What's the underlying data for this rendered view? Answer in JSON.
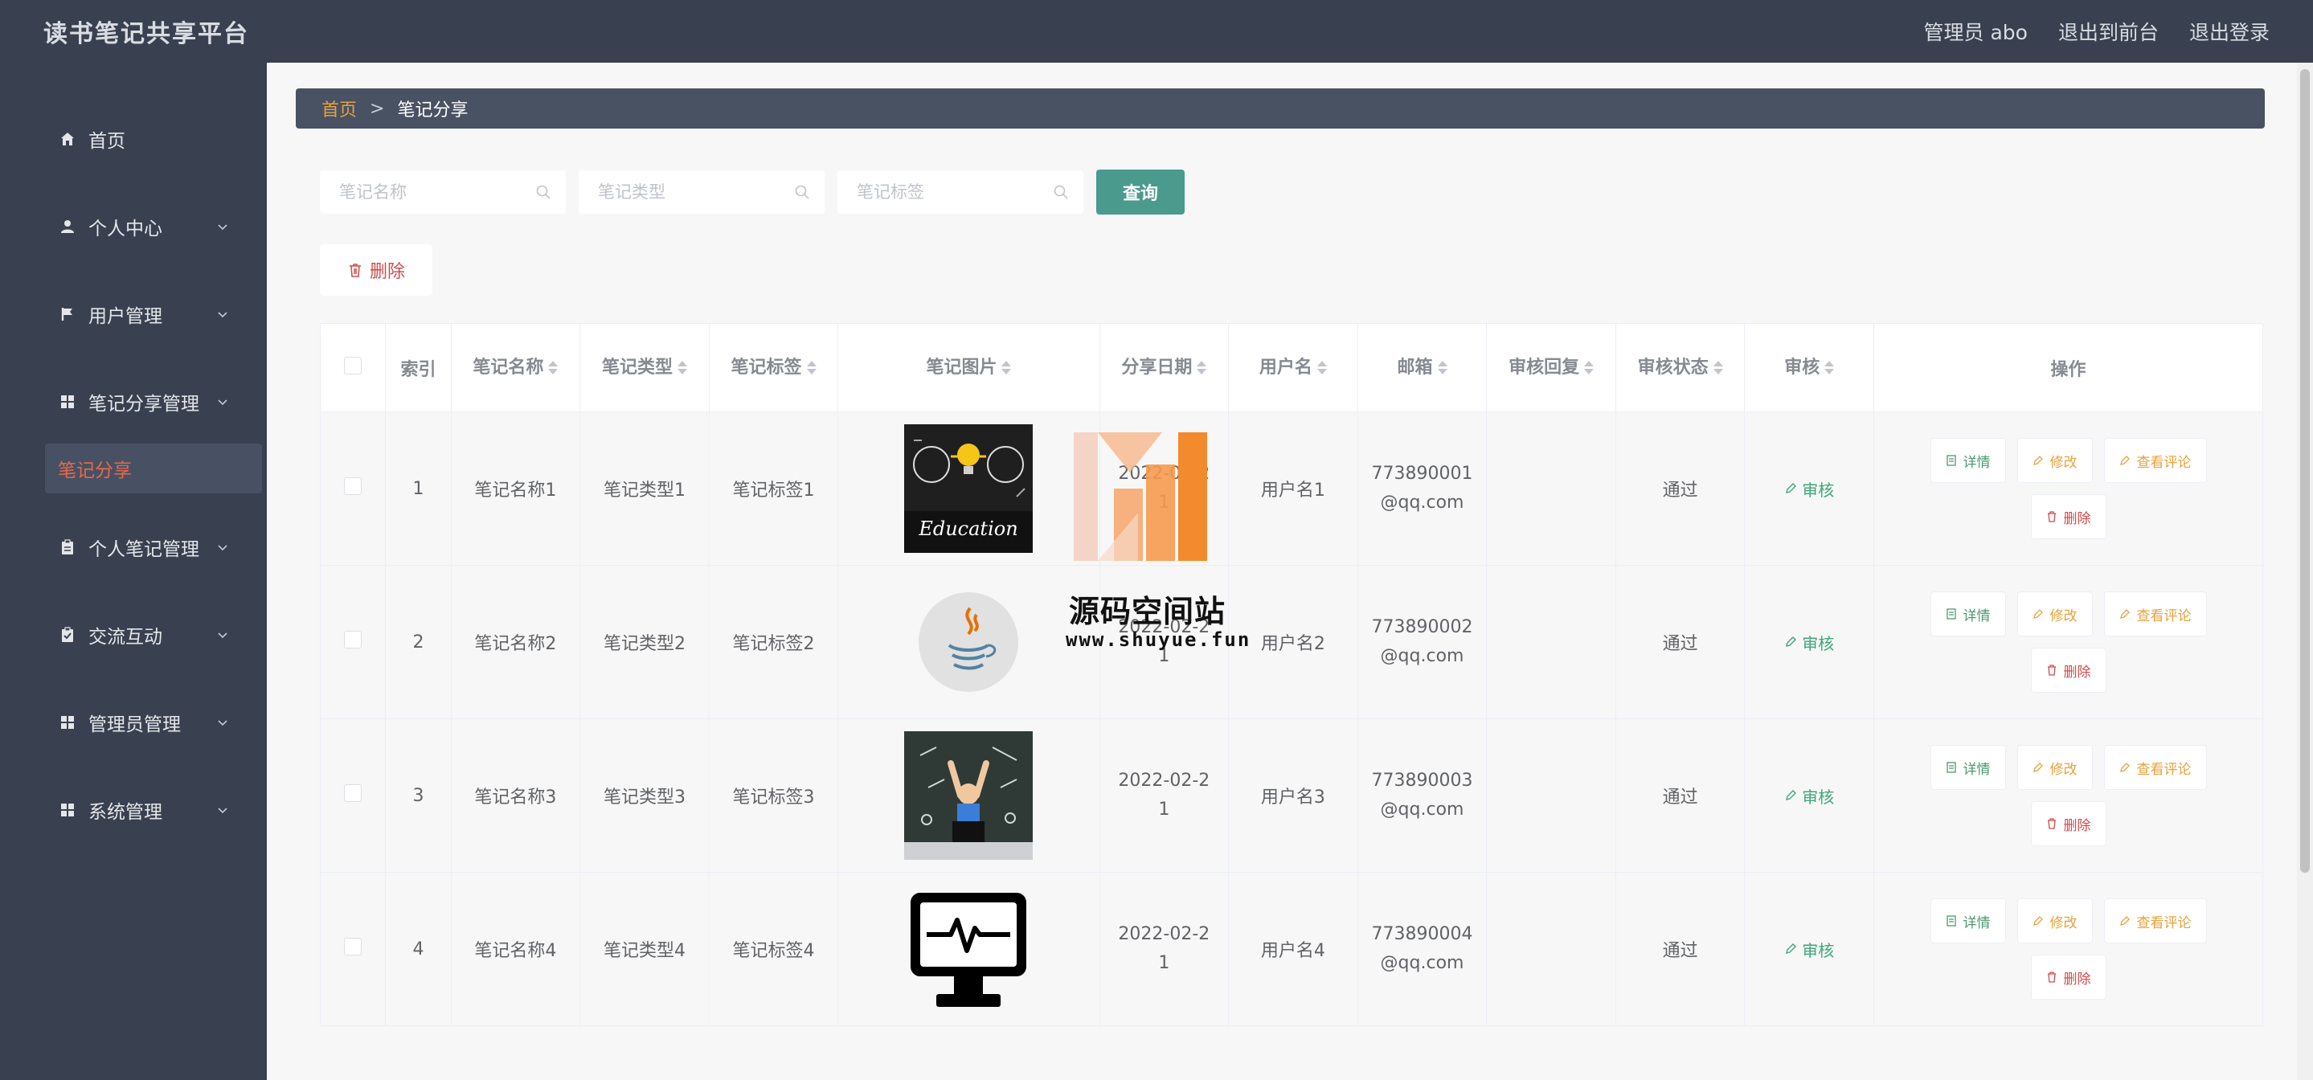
{
  "header": {
    "title": "读书笔记共享平台",
    "links": [
      "管理员 abo",
      "退出到前台",
      "退出登录"
    ]
  },
  "sidebar": {
    "items": [
      {
        "label": "首页",
        "icon": "home-icon",
        "has_children": false
      },
      {
        "label": "个人中心",
        "icon": "user-icon",
        "has_children": true
      },
      {
        "label": "用户管理",
        "icon": "flag-icon",
        "has_children": true
      },
      {
        "label": "笔记分享管理",
        "icon": "grid-icon",
        "has_children": true
      },
      {
        "label": "个人笔记管理",
        "icon": "clipboard-icon",
        "has_children": true
      },
      {
        "label": "交流互动",
        "icon": "check-clipboard-icon",
        "has_children": true
      },
      {
        "label": "管理员管理",
        "icon": "grid-icon",
        "has_children": true
      },
      {
        "label": "系统管理",
        "icon": "grid-icon",
        "has_children": true
      }
    ],
    "active_sub": "笔记分享"
  },
  "breadcrumb": {
    "home": "首页",
    "separator": ">",
    "current": "笔记分享"
  },
  "search": {
    "name_placeholder": "笔记名称",
    "type_placeholder": "笔记类型",
    "tag_placeholder": "笔记标签",
    "query_label": "查询"
  },
  "toolbar": {
    "delete_label": "删除"
  },
  "table": {
    "columns": [
      "索引",
      "笔记名称",
      "笔记类型",
      "笔记标签",
      "笔记图片",
      "分享日期",
      "用户名",
      "邮箱",
      "审核回复",
      "审核状态",
      "审核",
      "操作"
    ],
    "rows": [
      {
        "index": "1",
        "name": "笔记名称1",
        "type": "笔记类型1",
        "tag": "笔记标签1",
        "image": "education-image",
        "date": "2022-02-21",
        "user": "用户名1",
        "email": "773890001@qq.com",
        "reply": "",
        "status": "通过"
      },
      {
        "index": "2",
        "name": "笔记名称2",
        "type": "笔记类型2",
        "tag": "笔记标签2",
        "image": "java-logo-image",
        "date": "2022-02-21",
        "user": "用户名2",
        "email": "773890002@qq.com",
        "reply": "",
        "status": "通过"
      },
      {
        "index": "3",
        "name": "笔记名称3",
        "type": "笔记类型3",
        "tag": "笔记标签3",
        "image": "student-chalkboard-image",
        "date": "2022-02-21",
        "user": "用户名3",
        "email": "773890003@qq.com",
        "reply": "",
        "status": "通过"
      },
      {
        "index": "4",
        "name": "笔记名称4",
        "type": "笔记类型4",
        "tag": "笔记标签4",
        "image": "monitor-pulse-image",
        "date": "2022-02-21",
        "user": "用户名4",
        "email": "773890004@qq.com",
        "reply": "",
        "status": "通过"
      }
    ],
    "audit_label": "审核",
    "ops": {
      "detail": "详情",
      "edit": "修改",
      "comment": "查看评论",
      "delete": "删除"
    }
  },
  "watermark": {
    "title": "源码空间站",
    "url": "www.shuyue.fun"
  },
  "colors": {
    "header_bg": "#394150",
    "accent": "#4a9a8d",
    "active_sub": "#e9674c",
    "danger": "#d14b4b",
    "warning": "#e6a23c"
  }
}
